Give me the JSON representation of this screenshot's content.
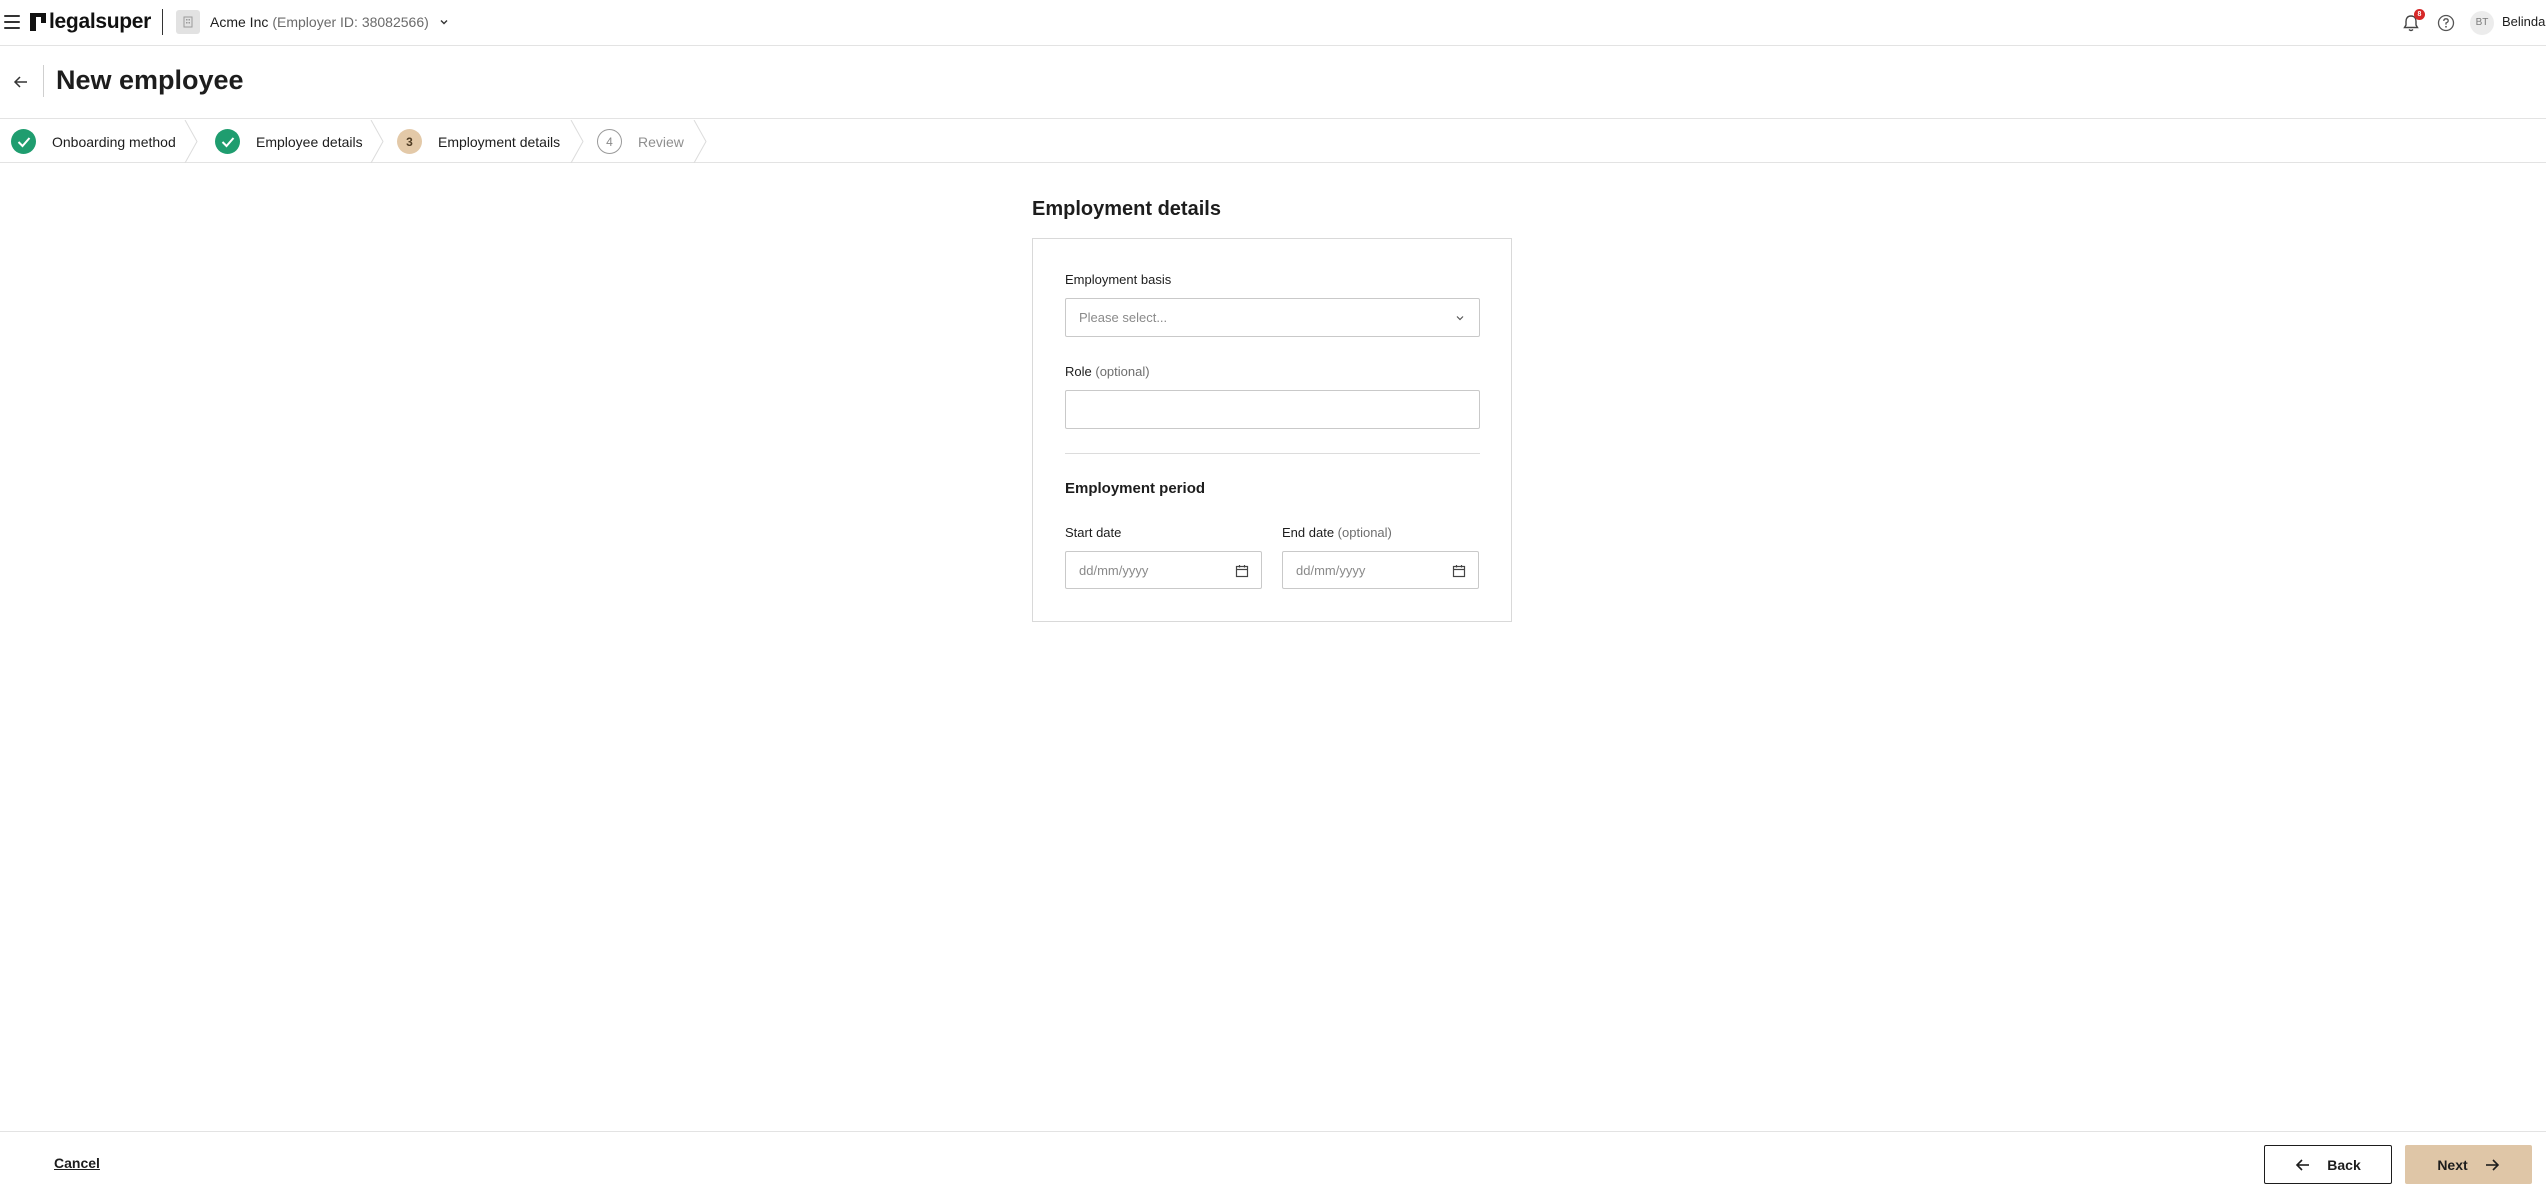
{
  "topbar": {
    "menu_icon": "hamburger-icon",
    "logo_text": "legalsuper",
    "employer": {
      "name": "Acme Inc",
      "id_text": "(Employer ID: 38082566)",
      "icon": "building-icon"
    },
    "notifications": {
      "icon": "bell-icon",
      "count": "8"
    },
    "help_icon": "question-circle-icon",
    "user": {
      "initials": "BT",
      "name": "Belinda"
    }
  },
  "page": {
    "back_icon": "arrow-left-icon",
    "title": "New employee"
  },
  "stepper": {
    "steps": [
      {
        "label": "Onboarding method",
        "state": "done",
        "number": ""
      },
      {
        "label": "Employee details",
        "state": "done",
        "number": ""
      },
      {
        "label": "Employment details",
        "state": "current",
        "number": "3"
      },
      {
        "label": "Review",
        "state": "todo",
        "number": "4"
      }
    ]
  },
  "form": {
    "section_title": "Employment details",
    "employment_basis": {
      "label": "Employment basis",
      "placeholder": "Please select..."
    },
    "role": {
      "label": "Role",
      "optional": "(optional)",
      "value": ""
    },
    "period_title": "Employment period",
    "start_date": {
      "label": "Start date",
      "placeholder": "dd/mm/yyyy"
    },
    "end_date": {
      "label": "End date",
      "optional": "(optional)",
      "placeholder": "dd/mm/yyyy"
    }
  },
  "footer": {
    "cancel": "Cancel",
    "back": "Back",
    "next": "Next"
  },
  "colors": {
    "step_done": "#1f9d6f",
    "step_current": "#e3c9a8",
    "next_button": "#dfc6a7",
    "badge": "#d62828"
  }
}
